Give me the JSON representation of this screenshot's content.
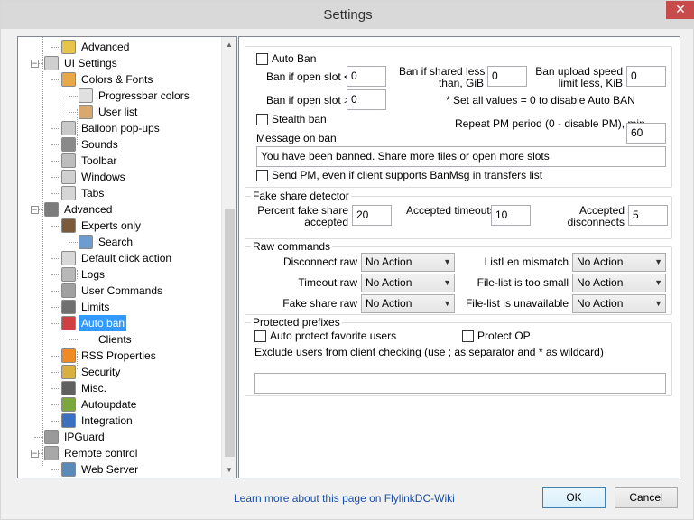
{
  "window": {
    "title": "Settings",
    "close_glyph": "✕"
  },
  "tree": {
    "items": [
      {
        "label": "Advanced",
        "icon": "key-icon",
        "color": "#e8c54a"
      },
      {
        "label": "UI Settings",
        "icon": "window-icon",
        "color": "#cfcfcf"
      },
      {
        "label": "Colors & Fonts",
        "icon": "palette-icon",
        "color": "#e8a848"
      },
      {
        "label": "Progressbar colors",
        "icon": "document-icon",
        "color": "#e0e0e0"
      },
      {
        "label": "User list",
        "icon": "users-icon",
        "color": "#d9a86c"
      },
      {
        "label": "Balloon pop-ups",
        "icon": "balloon-icon",
        "color": "#c9c9c9"
      },
      {
        "label": "Sounds",
        "icon": "speaker-icon",
        "color": "#8a8a8a"
      },
      {
        "label": "Toolbar",
        "icon": "toolbar-icon",
        "color": "#bdbdbd"
      },
      {
        "label": "Windows",
        "icon": "windows-icon",
        "color": "#d0d0d0"
      },
      {
        "label": "Tabs",
        "icon": "tabs-icon",
        "color": "#d6d6d6"
      },
      {
        "label": "Advanced",
        "icon": "tools-icon",
        "color": "#7c7c7c"
      },
      {
        "label": "Experts only",
        "icon": "expert-icon",
        "color": "#7a5a3a"
      },
      {
        "label": "Search",
        "icon": "search-icon",
        "color": "#6c9cd0"
      },
      {
        "label": "Default click action",
        "icon": "mouse-icon",
        "color": "#d8d8d8"
      },
      {
        "label": "Logs",
        "icon": "logs-icon",
        "color": "#b8b8b8"
      },
      {
        "label": "User Commands",
        "icon": "commands-icon",
        "color": "#a0a0a0"
      },
      {
        "label": "Limits",
        "icon": "limits-icon",
        "color": "#707070"
      },
      {
        "label": "Auto ban",
        "icon": "autoban-icon",
        "color": "#d04040"
      },
      {
        "label": "Clients",
        "icon": "none",
        "color": "#ffffff"
      },
      {
        "label": "RSS Properties",
        "icon": "rss-icon",
        "color": "#f08a24"
      },
      {
        "label": "Security",
        "icon": "lock-icon",
        "color": "#d8b040"
      },
      {
        "label": "Misc.",
        "icon": "monitor-icon",
        "color": "#606060"
      },
      {
        "label": "Autoupdate",
        "icon": "update-icon",
        "color": "#7aa83c"
      },
      {
        "label": "Integration",
        "icon": "integration-icon",
        "color": "#3c6fc0"
      },
      {
        "label": "IPGuard",
        "icon": "ipguard-icon",
        "color": "#9a9a9a"
      },
      {
        "label": "Remote control",
        "icon": "remote-icon",
        "color": "#a8a8a8"
      },
      {
        "label": "Web Server",
        "icon": "webserver-icon",
        "color": "#5a8ab8"
      }
    ]
  },
  "auto_ban": {
    "auto_ban_label": "Auto Ban",
    "open_slot_lt_label": "Ban if open slot <",
    "open_slot_lt_value": "0",
    "open_slot_gt_label": "Ban if open slot >",
    "open_slot_gt_value": "0",
    "shared_less_label_1": "Ban if shared less",
    "shared_less_label_2": "than, GiB",
    "shared_less_value": "0",
    "upload_limit_label_1": "Ban upload speed",
    "upload_limit_label_2": "limit less, KiB",
    "upload_limit_value": "0",
    "note": "* Set all values = 0 to disable Auto BAN",
    "stealth_label": "Stealth ban",
    "repeat_pm_label": "Repeat PM period (0 - disable PM), min",
    "repeat_pm_value": "60",
    "message_label": "Message on ban",
    "message_value": "You have been banned. Share more files or open more slots",
    "send_pm_label": "Send PM, even if client supports BanMsg in transfers list"
  },
  "fake_share": {
    "title": "Fake share detector",
    "percent_label_1": "Percent fake share",
    "percent_label_2": "accepted",
    "percent_value": "20",
    "timeouts_label": "Accepted timeouts",
    "timeouts_value": "10",
    "disconnects_label_1": "Accepted",
    "disconnects_label_2": "disconnects",
    "disconnects_value": "5"
  },
  "raw_commands": {
    "title": "Raw commands",
    "rows": [
      {
        "left_label": "Disconnect raw",
        "left_value": "No Action",
        "right_label": "ListLen mismatch",
        "right_value": "No Action"
      },
      {
        "left_label": "Timeout raw",
        "left_value": "No Action",
        "right_label": "File-list is too small",
        "right_value": "No Action"
      },
      {
        "left_label": "Fake share raw",
        "left_value": "No Action",
        "right_label": "File-list is unavailable",
        "right_value": "No Action"
      }
    ]
  },
  "protected": {
    "title": "Protected prefixes",
    "auto_protect_label": "Auto protect favorite users",
    "protect_op_label": "Protect OP",
    "exclude_label": "Exclude users from client checking (use ; as separator and * as wildcard)",
    "exclude_value": ""
  },
  "footer": {
    "link_text": "Learn more about this page on FlylinkDC-Wiki",
    "ok_label": "OK",
    "cancel_label": "Cancel"
  }
}
